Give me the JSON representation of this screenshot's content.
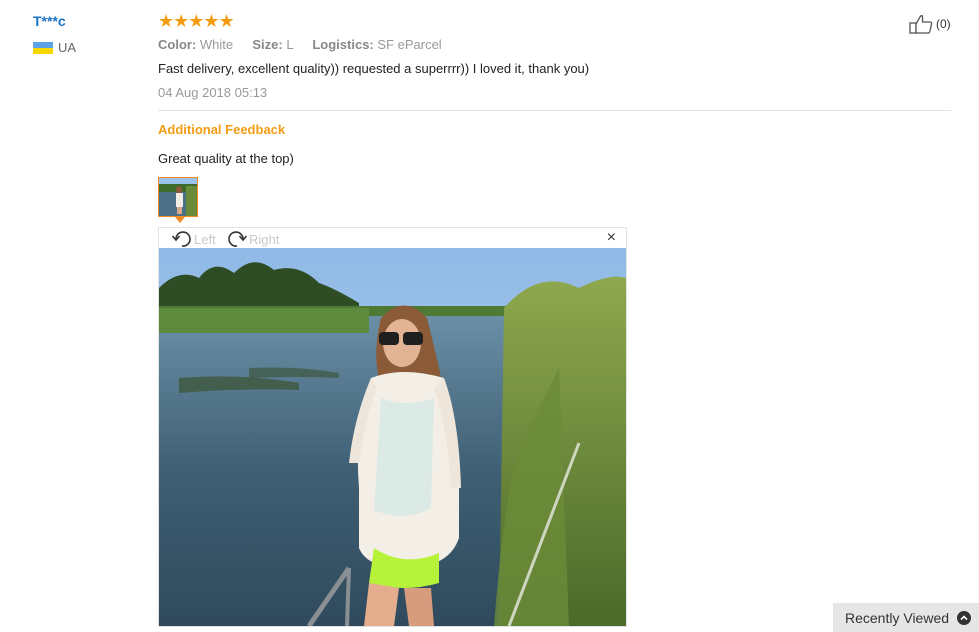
{
  "review": {
    "user_name": "T***c",
    "country": "UA",
    "rating": "★★★★★",
    "attributes": [
      {
        "key": "Color:",
        "value": "White"
      },
      {
        "key": "Size:",
        "value": "L"
      },
      {
        "key": "Logistics:",
        "value": "SF eParcel"
      }
    ],
    "text": "Fast delivery, excellent quality)) requested a superrrr)) I loved it, thank you)",
    "date": "04 Aug 2018 05:13",
    "likes": "(0)"
  },
  "additional_feedback": {
    "title": "Additional Feedback",
    "text": "Great quality at the top)"
  },
  "viewer": {
    "rotate_left_label": "Left",
    "rotate_right_label": "Right",
    "close_glyph": "×"
  },
  "recently_viewed": {
    "label": "Recently Viewed"
  },
  "colors": {
    "username": "#1a73c6",
    "accent_orange": "#f39c12",
    "thumb_border": "#f08a24"
  }
}
